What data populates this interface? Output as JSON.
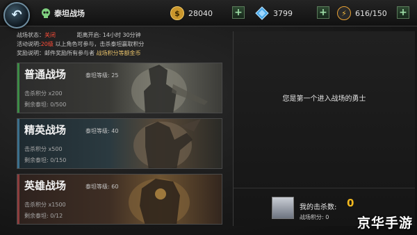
{
  "header": {
    "title": "泰坦战场",
    "gold": "28040",
    "gems": "3799",
    "stamina": "616/150"
  },
  "info": {
    "status_label": "战场状态：",
    "status_value": "关闭",
    "countdown": "距离开启: 14小时 30分钟",
    "activity_label": "活动说明:",
    "activity_level": "20级",
    "activity_text": "以上角色可参与，击杀泰坦赢取积分",
    "reward_label": "奖励说明：邮件奖励所有参与者",
    "reward_value": "战场积分等额金币"
  },
  "cards": [
    {
      "name": "普通战场",
      "level": "泰坦等级: 25",
      "kill": "击杀积分  x200",
      "remain": "剩余泰坦:  0/500"
    },
    {
      "name": "精英战场",
      "level": "泰坦等级: 40",
      "kill": "击杀积分  x500",
      "remain": "剩余泰坦:  0/150"
    },
    {
      "name": "英雄战场",
      "level": "泰坦等级: 60",
      "kill": "击杀积分  x1500",
      "remain": "剩余泰坦:  0/12"
    }
  ],
  "panel": {
    "first_message": "您是第一个进入战场的勇士",
    "my_kills_label": "我的击杀数:",
    "my_kills_value": "0",
    "my_score": "战场积分: 0"
  },
  "watermark": "京华手游",
  "colors": {
    "accent_green": "#3c8c45",
    "status_red": "#ff4e3a",
    "gold_text": "#e8c26a",
    "kills_value": "#f2b81e"
  },
  "icons": [
    "back-arrow-icon",
    "skull-icon",
    "gold-coin-icon",
    "gem-icon",
    "lightning-icon",
    "plus-icon"
  ]
}
